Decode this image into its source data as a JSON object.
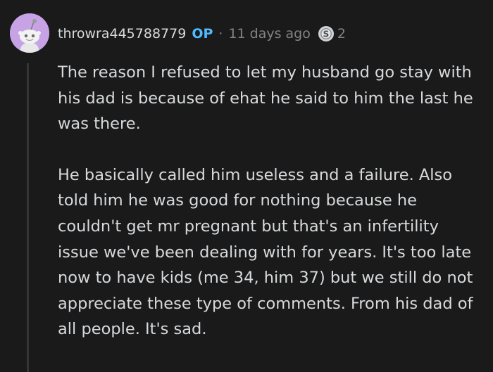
{
  "comment": {
    "username": "throwra445788779",
    "op_badge": "OP",
    "separator": "·",
    "timestamp": "11 days ago",
    "award_icon": "silver-award-icon",
    "award_count": "2",
    "paragraphs": [
      "The reason I refused to let my husband go stay with his dad is because of ehat he said to him the last he was there.",
      "He basically called him useless and a failure. Also told him he was good for nothing because he couldn't get mr pregnant but that's an infertility issue we've been dealing with for years. It's too late now to have kids (me 34, him 37) but we still do not appreciate these type of comments. From his dad of all people. It's sad."
    ]
  },
  "colors": {
    "background": "#1a1a1b",
    "text": "#d7dadc",
    "muted": "#818384",
    "op": "#4fbcff",
    "avatar_bg": "#c7a3e6",
    "thread_line": "#343536"
  }
}
